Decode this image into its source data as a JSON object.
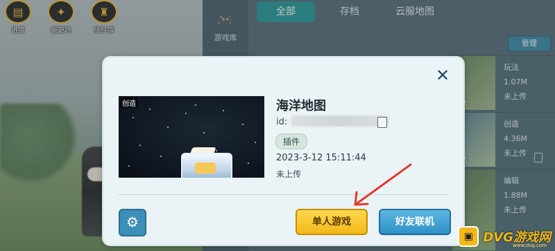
{
  "top_buttons": [
    {
      "label": "进度",
      "icon": "progress-icon"
    },
    {
      "label": "星更场",
      "icon": "star-icon"
    },
    {
      "label": "插件库",
      "icon": "plugin-icon"
    }
  ],
  "library": {
    "side_label": "游戏库",
    "tabs": [
      "全部",
      "存档",
      "云服地图"
    ],
    "manage_label": "管理",
    "rows": [
      {
        "caption": "玩法",
        "type": "玩法",
        "size": "1.07M",
        "status": "未上传"
      },
      {
        "caption": "创造",
        "type": "创造",
        "size": "4.36M",
        "status": "未上传"
      },
      {
        "caption": "",
        "type": "编辑",
        "size": "1.88M",
        "status": "未上传"
      }
    ]
  },
  "dialog": {
    "cover_badge": "创造",
    "map_title": "海洋地图",
    "id_label": "id:",
    "tag": "插件",
    "date": "2023-3-12   15:11:44",
    "status": "未上传",
    "single_player_label": "单人游戏",
    "friends_label": "好友联机"
  },
  "watermark": {
    "text": "DVG游戏网",
    "sub": "www.dvg.com"
  },
  "colors": {
    "accent_teal": "#2e9a9a",
    "primary_yellow": "#f2b81a",
    "primary_blue": "#2e91c7",
    "annotation_red": "#e23a2a"
  }
}
